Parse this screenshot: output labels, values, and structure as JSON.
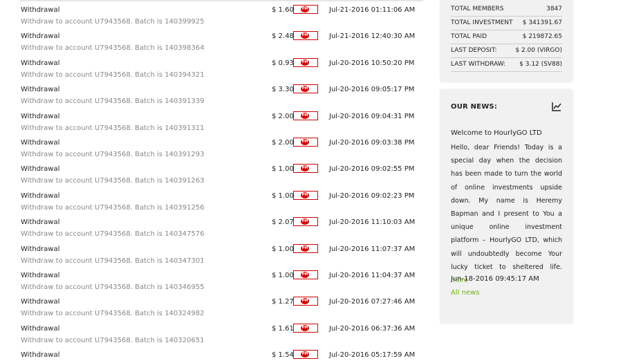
{
  "transactions": [
    {
      "type": "Withdrawal",
      "amount": "$ 1.60",
      "date": "Jul-21-2016 01:11:06 AM",
      "desc": "Withdraw to account U7943568. Batch is 140399925"
    },
    {
      "type": "Withdrawal",
      "amount": "$ 2.48",
      "date": "Jul-21-2016 12:40:30 AM",
      "desc": "Withdraw to account U7943568. Batch is 140398364"
    },
    {
      "type": "Withdrawal",
      "amount": "$ 0.93",
      "date": "Jul-20-2016 10:50:20 PM",
      "desc": "Withdraw to account U7943568. Batch is 140394321"
    },
    {
      "type": "Withdrawal",
      "amount": "$ 3.30",
      "date": "Jul-20-2016 09:05:17 PM",
      "desc": "Withdraw to account U7943568. Batch is 140391339"
    },
    {
      "type": "Withdrawal",
      "amount": "$ 2.00",
      "date": "Jul-20-2016 09:04:31 PM",
      "desc": "Withdraw to account U7943568. Batch is 140391311"
    },
    {
      "type": "Withdrawal",
      "amount": "$ 2.00",
      "date": "Jul-20-2016 09:03:38 PM",
      "desc": "Withdraw to account U7943568. Batch is 140391293"
    },
    {
      "type": "Withdrawal",
      "amount": "$ 1.00",
      "date": "Jul-20-2016 09:02:55 PM",
      "desc": "Withdraw to account U7943568. Batch is 140391263"
    },
    {
      "type": "Withdrawal",
      "amount": "$ 1.00",
      "date": "Jul-20-2016 09:02:23 PM",
      "desc": "Withdraw to account U7943568. Batch is 140391256"
    },
    {
      "type": "Withdrawal",
      "amount": "$ 2.07",
      "date": "Jul-20-2016 11:10:03 AM",
      "desc": "Withdraw to account U7943568. Batch is 140347576"
    },
    {
      "type": "Withdrawal",
      "amount": "$ 1.00",
      "date": "Jul-20-2016 11:07:37 AM",
      "desc": "Withdraw to account U7943568. Batch is 140347301"
    },
    {
      "type": "Withdrawal",
      "amount": "$ 1.00",
      "date": "Jul-20-2016 11:04:37 AM",
      "desc": "Withdraw to account U7943568. Batch is 140346955"
    },
    {
      "type": "Withdrawal",
      "amount": "$ 1.27",
      "date": "Jul-20-2016 07:27:46 AM",
      "desc": "Withdraw to account U7943568. Batch is 140324982"
    },
    {
      "type": "Withdrawal",
      "amount": "$ 1.61",
      "date": "Jul-20-2016 06:37:36 AM",
      "desc": "Withdraw to account U7943568. Batch is 140320651"
    },
    {
      "type": "Withdrawal",
      "amount": "$ 1.54",
      "date": "Jul-20-2016 05:17:59 AM",
      "desc": ""
    }
  ],
  "payment_badge": "PM",
  "stats": [
    {
      "label": "TOTAL MEMBERS",
      "value": "3847"
    },
    {
      "label": "TOTAL INVESTMENT",
      "value": "$ 341391.67"
    },
    {
      "label": "TOTAL PAID",
      "value": "$ 219872.65"
    },
    {
      "label": "LAST DEPOSIT:",
      "value": "$ 2.00 (VIRGO)"
    },
    {
      "label": "LAST WITHDRAW:",
      "value": "$ 3.12 (SV88)"
    }
  ],
  "news": {
    "title": "OUR NEWS:",
    "heading": "Welcome to HourlyGO LTD",
    "body": "Hello, dear Friends! Today is a special day when the decision has been made to turn the world of online investments upside down. My name is Heremy Bapman and I present to You a unique online investment platform – HourlyGO LTD, which will undoubtedly become Your lucky ticket to sheltered life.",
    "more_label": "more",
    "date": "Jun-18-2016 09:45:17 AM",
    "all_news_label": "All news"
  },
  "colors": {
    "accent_green": "#6fb319",
    "pm_red": "#d50000"
  }
}
